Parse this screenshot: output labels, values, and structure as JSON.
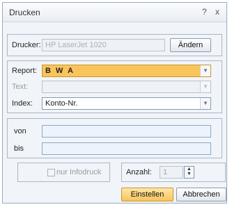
{
  "window": {
    "title": "Drucken",
    "help_glyph": "?",
    "close_glyph": "x"
  },
  "printer": {
    "label": "Drucker:",
    "value": "HP LaserJet 1020",
    "change_label": "Ändern"
  },
  "report": {
    "report_label": "Report:",
    "report_value": "B W A",
    "text_label": "Text:",
    "text_value": "",
    "index_label": "Index:",
    "index_value": "Konto-Nr."
  },
  "range": {
    "from_label": "von",
    "from_value": "",
    "to_label": "bis",
    "to_value": ""
  },
  "options": {
    "infodruck_label": "nur Infodruck",
    "infodruck_checked": false,
    "count_label": "Anzahl:",
    "count_value": "1"
  },
  "actions": {
    "settings_label": "Einstellen",
    "cancel_label": "Abbrechen"
  },
  "colors": {
    "highlight": "#f9c45a",
    "border": "#aab7c7"
  },
  "icons": {
    "dropdown": "chevron-down-icon",
    "spinner": "spin-arrows-icon"
  }
}
